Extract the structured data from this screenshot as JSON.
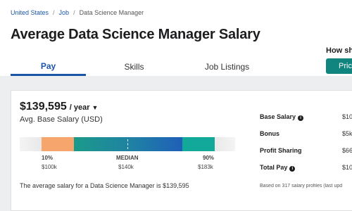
{
  "breadcrumb": {
    "items": [
      "United States",
      "Job",
      "Data Science Manager"
    ],
    "separator": "/"
  },
  "page_title": "Average Data Science Manager Salary",
  "tabs": [
    {
      "label": "Pay",
      "active": true
    },
    {
      "label": "Skills",
      "active": false
    },
    {
      "label": "Job Listings",
      "active": false
    }
  ],
  "cta": {
    "text": "How sho",
    "button_label": "Pric"
  },
  "salary": {
    "amount": "$139,595",
    "period": "/ year",
    "label": "Avg. Base Salary (USD)"
  },
  "distribution": {
    "percentiles": [
      {
        "label": "10%",
        "value": "$100k"
      },
      {
        "label": "MEDIAN",
        "value": "$140k"
      },
      {
        "label": "90%",
        "value": "$183k"
      }
    ],
    "colors": {
      "low": "#f6a66c",
      "mid_start": "#1b9a8a",
      "mid_end": "#1f5fb8",
      "high": "#12a89a"
    }
  },
  "summary_sentence": "The average salary for a Data Science Manager is $139,595",
  "side_table": {
    "rows": [
      {
        "label": "Base Salary",
        "value": "$10",
        "info": true
      },
      {
        "label": "Bonus",
        "value": "$5k",
        "info": false
      },
      {
        "label": "Profit Sharing",
        "value": "$66",
        "info": false
      },
      {
        "label": "Total Pay",
        "value": "$10",
        "info": true
      }
    ],
    "footnote": "Based on 317 salary profiles (last upd"
  }
}
